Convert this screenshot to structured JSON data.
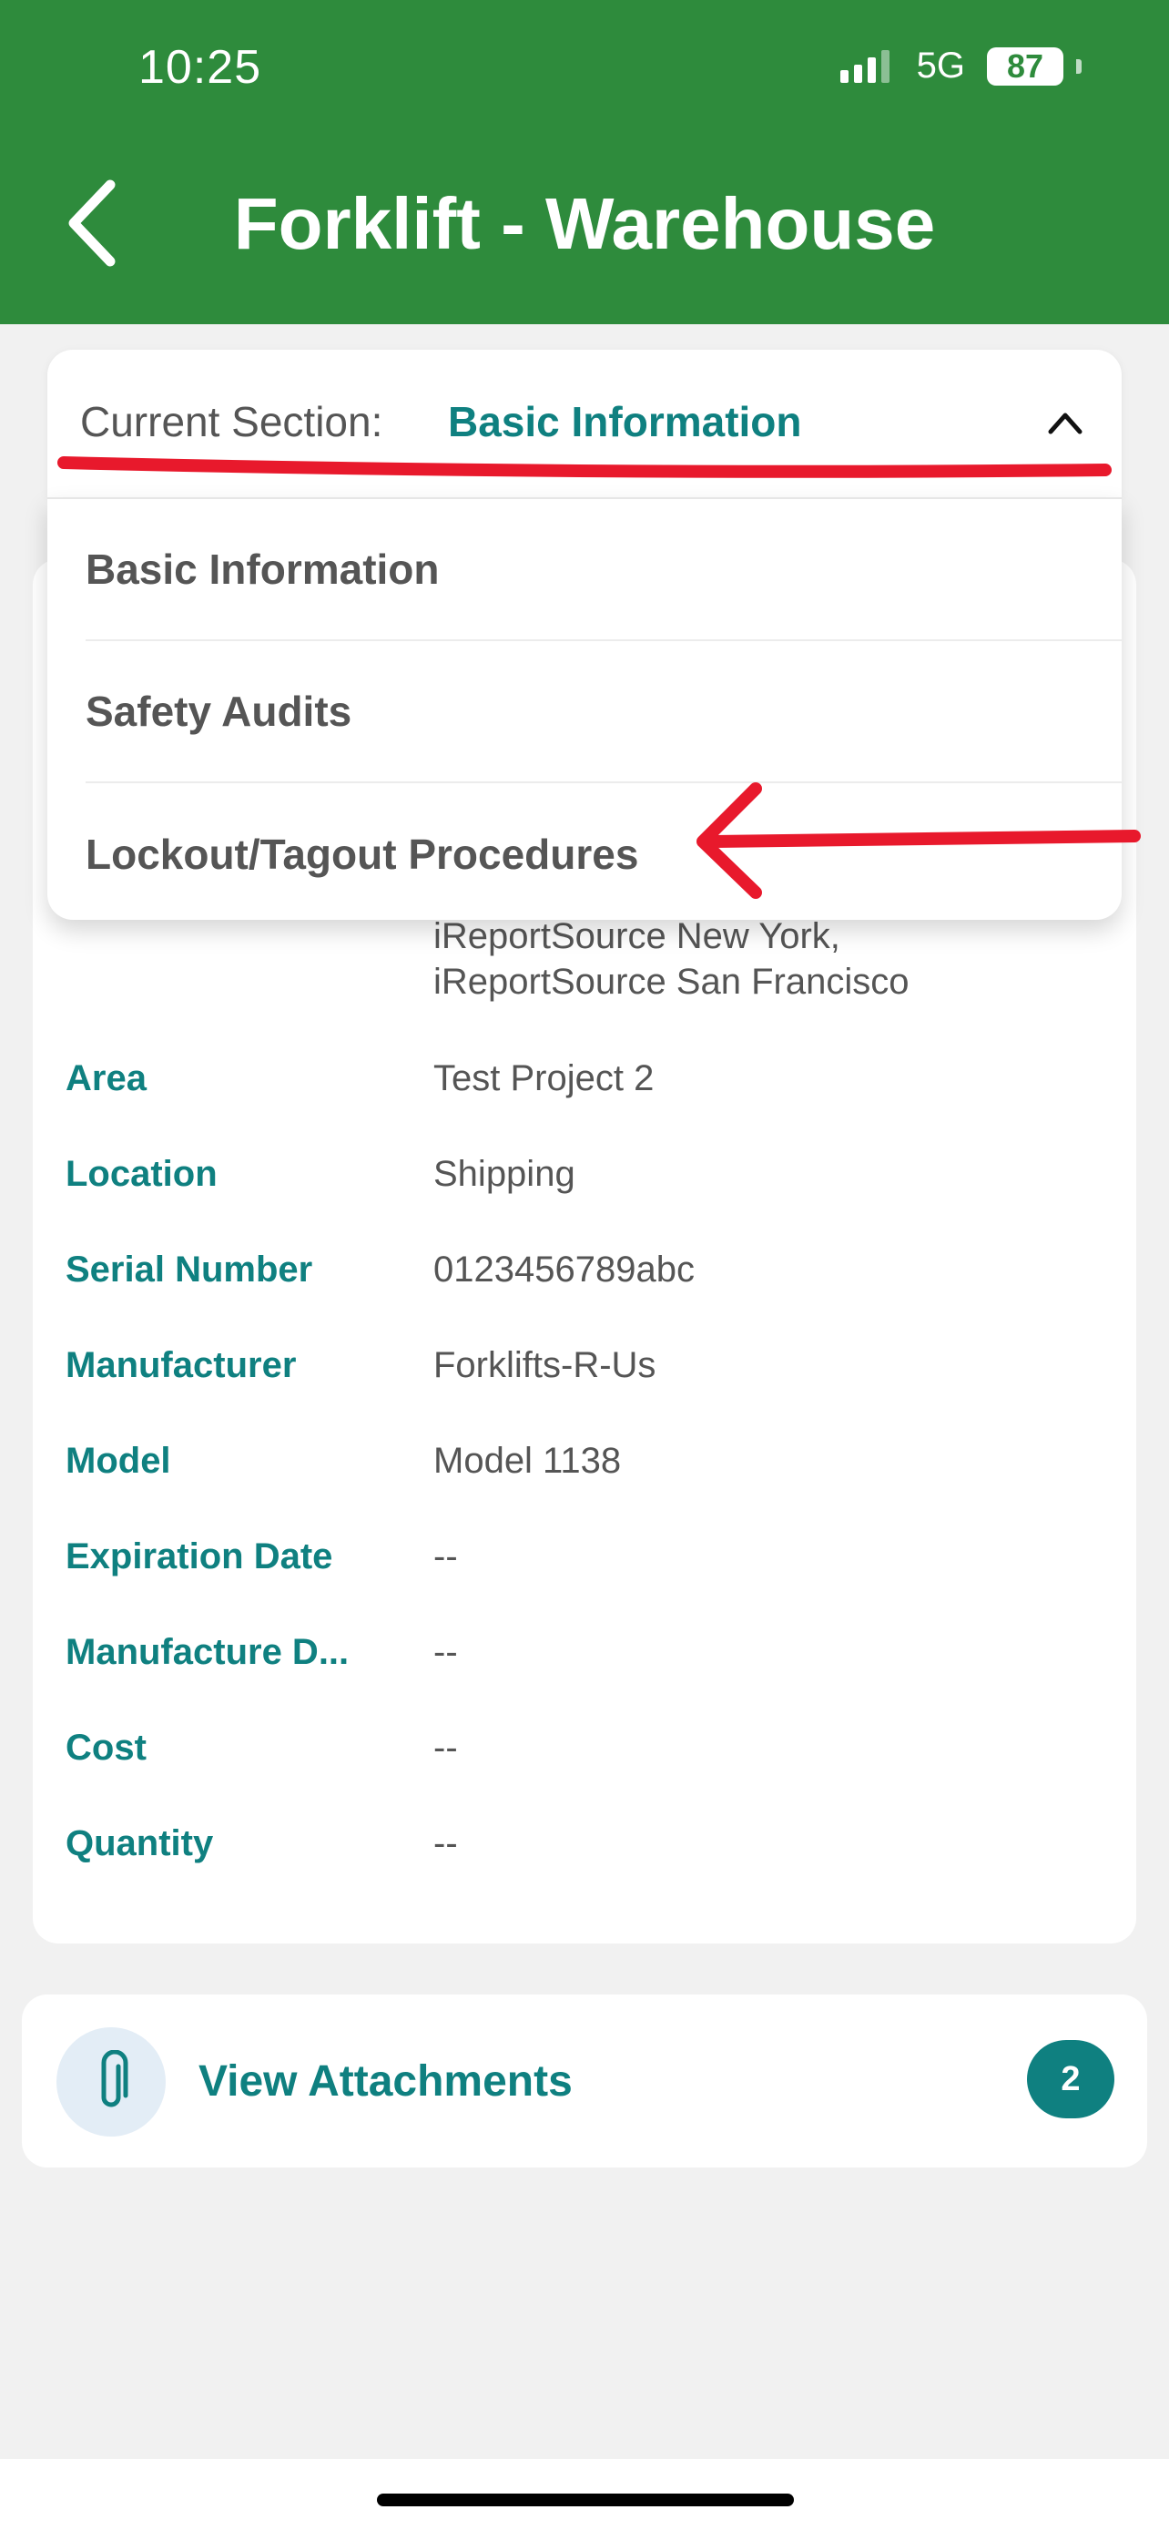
{
  "status_bar": {
    "time": "10:25",
    "network": "5G",
    "battery": "87"
  },
  "header": {
    "title": "Forklift - Warehouse",
    "back_icon": "chevron-left-icon"
  },
  "section_selector": {
    "label": "Current Section:",
    "value": "Basic Information",
    "toggle_icon": "chevron-up-icon",
    "options": [
      "Basic Information",
      "Safety Audits",
      "Lockout/Tagout Procedures"
    ]
  },
  "details": {
    "partial_value_lines": [
      "iReportSource New York,",
      "iReportSource San Francisco"
    ],
    "rows": [
      {
        "label": "Area",
        "value": "Test Project 2"
      },
      {
        "label": "Location",
        "value": "Shipping"
      },
      {
        "label": "Serial Number",
        "value": "0123456789abc"
      },
      {
        "label": "Manufacturer",
        "value": "Forklifts-R-Us"
      },
      {
        "label": "Model",
        "value": "Model 1138"
      },
      {
        "label": "Expiration Date",
        "value": "--"
      },
      {
        "label": "Manufacture D...",
        "value": "--"
      },
      {
        "label": "Cost",
        "value": "--"
      },
      {
        "label": "Quantity",
        "value": "--"
      }
    ]
  },
  "attachments": {
    "label": "View Attachments",
    "count": "2",
    "icon": "paperclip-icon"
  },
  "colors": {
    "header_green": "#2e8b3c",
    "teal": "#0f8080",
    "annotation_red": "#e8192c"
  }
}
